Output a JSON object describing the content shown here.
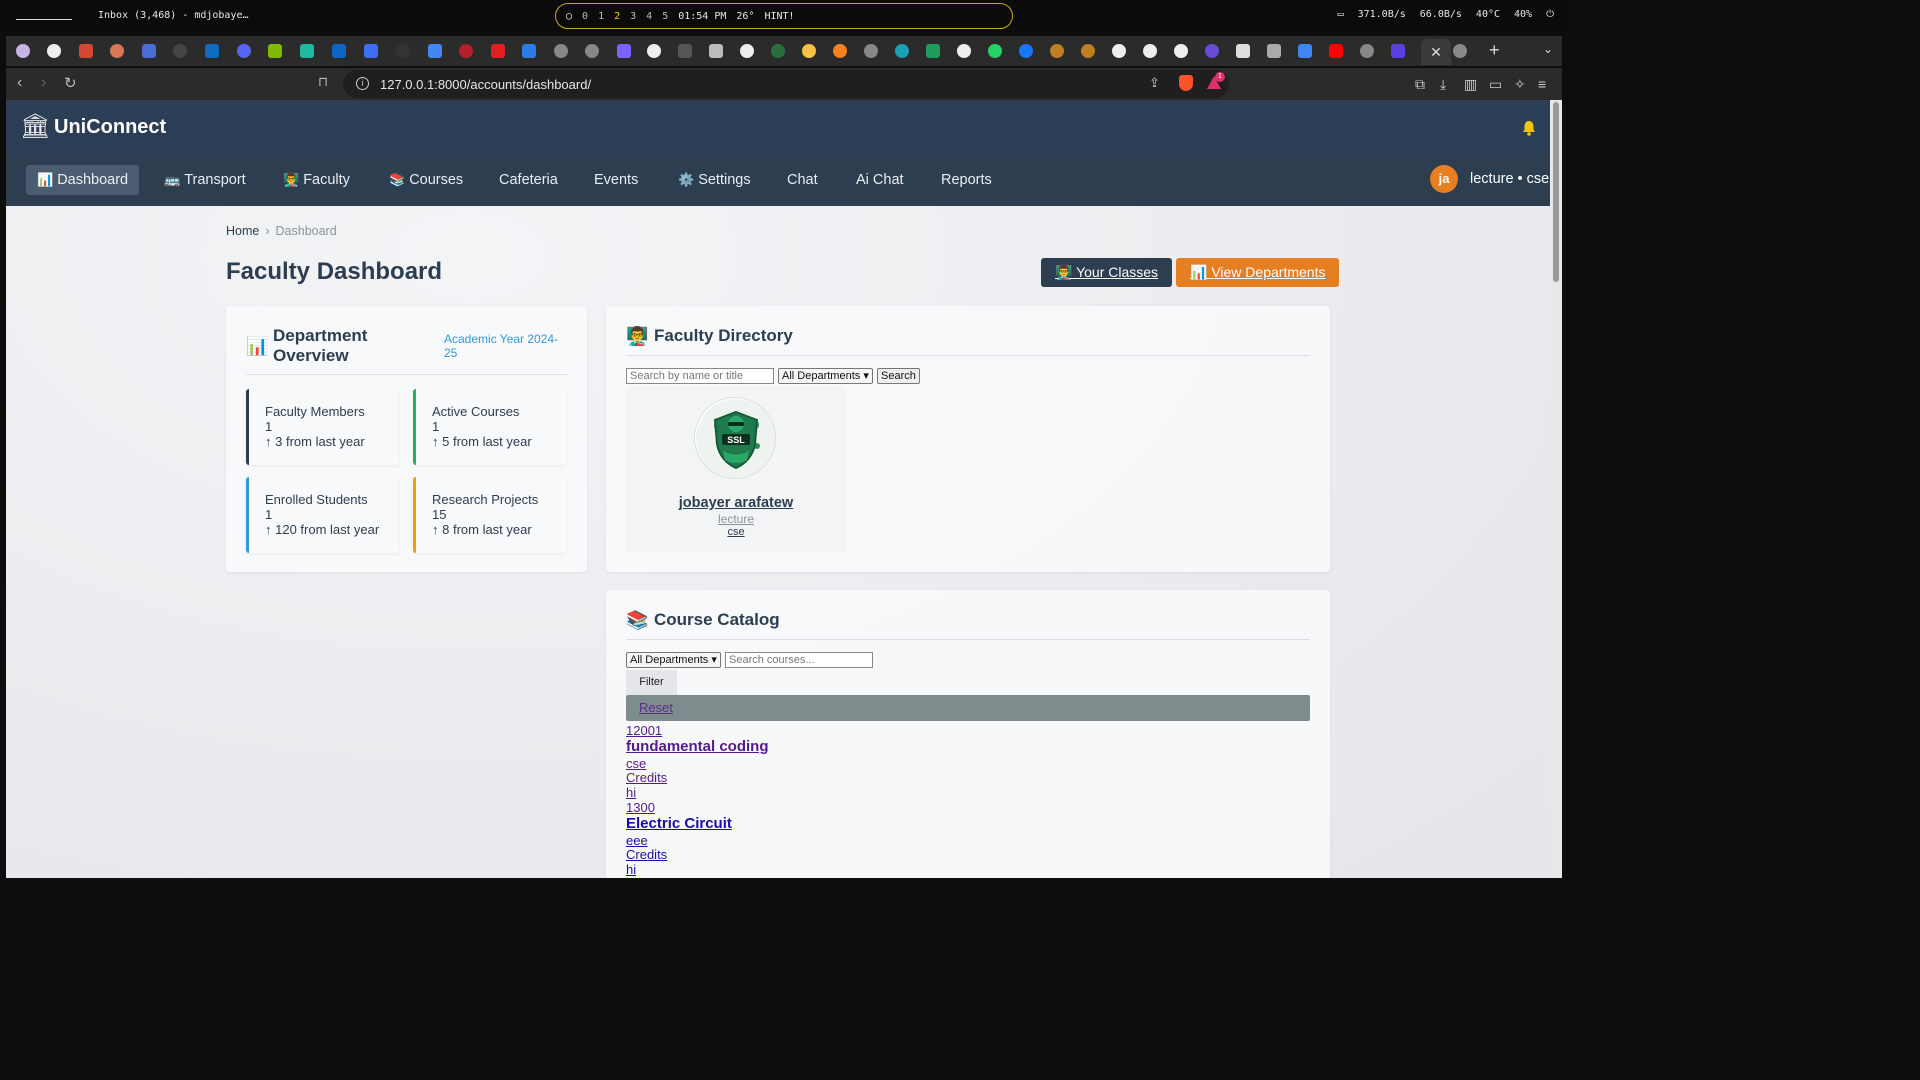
{
  "system_bar": {
    "window_title": "Inbox (3,468) - mdjobaye…",
    "workspaces": [
      "0",
      "1",
      "2",
      "3",
      "4",
      "5"
    ],
    "clock": "01:54 PM",
    "weather": "26°",
    "hint": "HINT!",
    "net_down": "371.0B/s",
    "net_up": "66.0B/s",
    "temp": "40°C",
    "volume": "40%"
  },
  "browser": {
    "url": "127.0.0.1:8000/accounts/dashboard/",
    "rewards_count": "1"
  },
  "app": {
    "brand": "UniConnect",
    "nav": [
      {
        "label": "Dashboard",
        "icon": "📊"
      },
      {
        "label": "Transport",
        "icon": "🚌"
      },
      {
        "label": "Faculty",
        "icon": "👨‍🏫"
      },
      {
        "label": "Courses",
        "icon": "📚"
      },
      {
        "label": "Cafeteria",
        "icon": ""
      },
      {
        "label": "Events",
        "icon": ""
      },
      {
        "label": "Settings",
        "icon": "⚙️"
      },
      {
        "label": "Chat",
        "icon": ""
      },
      {
        "label": "Ai Chat",
        "icon": ""
      },
      {
        "label": "Reports",
        "icon": ""
      }
    ],
    "user": {
      "initials": "ja",
      "label": "lecture • cse"
    }
  },
  "breadcrumb": {
    "home": "Home",
    "sep": "›",
    "current": "Dashboard"
  },
  "page_title": "Faculty Dashboard",
  "actions": {
    "your_classes": "Your Classes",
    "your_classes_icon": "👨‍🏫",
    "view_departments": "View Departments",
    "view_departments_icon": "📊"
  },
  "department_overview": {
    "icon": "📊",
    "title": "Department Overview",
    "academic_year": "Academic Year 2024-25",
    "stats": [
      {
        "label": "Faculty Members",
        "value": "1",
        "change": "↑ 3 from last year",
        "color": "#2c3e50"
      },
      {
        "label": "Active Courses",
        "value": "1",
        "change": "↑ 5 from last year",
        "color": "#27ae60"
      },
      {
        "label": "Enrolled Students",
        "value": "1",
        "change": "↑ 120 from last year",
        "color": "#3498db"
      },
      {
        "label": "Research Projects",
        "value": "15",
        "change": "↑ 8 from last year",
        "color": "#f39c12"
      }
    ]
  },
  "faculty_directory": {
    "icon": "👨‍🏫",
    "title": "Faculty Directory",
    "search_placeholder": "Search by name or title",
    "dept_select": "All Departments",
    "search_btn": "Search",
    "members": [
      {
        "name": "jobayer arafatew",
        "role": "lecture",
        "dept": "cse",
        "avatar_text": "SSL"
      }
    ]
  },
  "course_catalog": {
    "icon": "📚",
    "title": "Course Catalog",
    "dept_select": "All Departments",
    "search_placeholder": "Search courses...",
    "filter_btn": "Filter",
    "reset": "Reset",
    "courses": [
      {
        "code": "12001",
        "name": "fundamental coding",
        "dept": "cse",
        "credits": "Credits",
        "desc": "hi"
      },
      {
        "code": "1300",
        "name": "Electric Circuit",
        "dept": "eee",
        "credits": "Credits",
        "desc": "hi"
      }
    ]
  }
}
